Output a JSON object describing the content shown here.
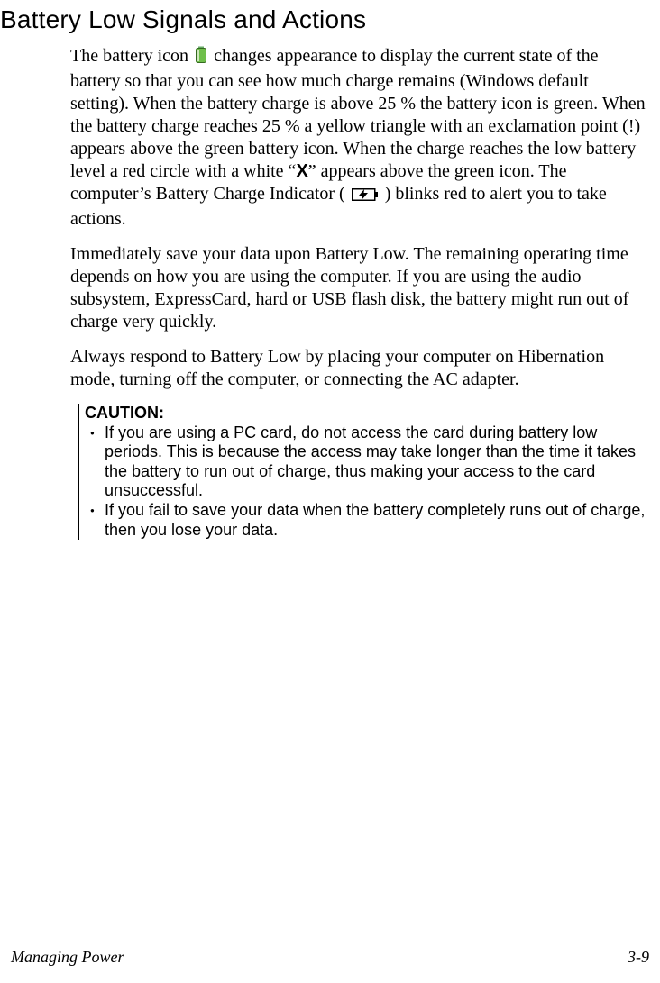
{
  "heading": "Battery Low Signals and Actions",
  "paragraphs": {
    "p1a": "The battery icon ",
    "p1b": " changes appearance to display the current state of the battery so that you can see how much charge remains (Windows default setting). When the battery charge is above 25 % the battery icon is green. When the battery charge reaches 25 % a yellow triangle with an exclamation point (!) appears above the green battery icon. When the charge reaches the low battery level a red circle with a white “",
    "p1x": "X",
    "p1c": "” appears above the green icon. The computer’s Battery Charge Indicator ( ",
    "p1d": " ) blinks red to alert you to take actions.",
    "p2": "Immediately save your data upon Battery Low. The remaining operating time depends on how you are using the computer. If you are using the audio subsystem, ExpressCard, hard or USB flash disk, the battery might run out of charge very quickly.",
    "p3": "Always respond to Battery Low by placing your computer on Hibernation mode, turning off the computer, or connecting the AC adapter."
  },
  "caution": {
    "title": "CAUTION:",
    "items": [
      "If you are using a PC card, do not access the card during battery low periods. This is because the access may take longer than the time it takes the battery to run out of charge, thus making your access to the card unsuccessful.",
      "If you fail to save your data when the battery completely runs out of charge, then you lose your data."
    ]
  },
  "footer": {
    "left": "Managing Power",
    "right": "3-9"
  },
  "icons": {
    "battery": "battery-icon",
    "charge_indicator": "charge-indicator-icon"
  }
}
